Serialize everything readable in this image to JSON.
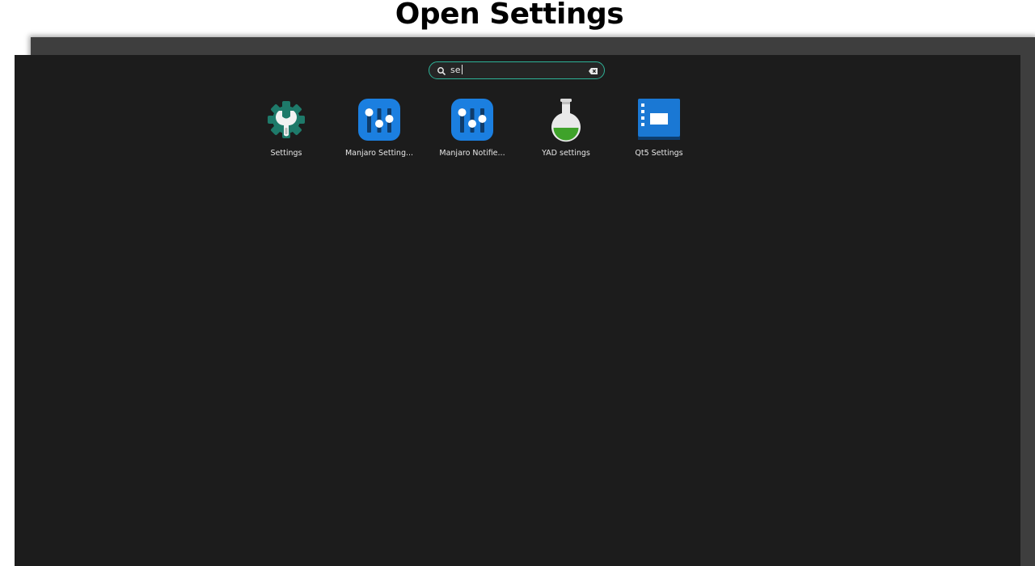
{
  "caption": "Open Settings",
  "search": {
    "value": "se",
    "icons": {
      "search": "search-icon",
      "clear": "backspace-clear-icon"
    }
  },
  "apps": [
    {
      "label": "Settings",
      "icon": "wrench-gear-icon"
    },
    {
      "label": "Manjaro Setting...",
      "icon": "sliders-icon"
    },
    {
      "label": "Manjaro Notifie...",
      "icon": "sliders-icon"
    },
    {
      "label": "YAD settings",
      "icon": "flask-icon"
    },
    {
      "label": "Qt5 Settings",
      "icon": "window-panel-icon"
    }
  ],
  "colors": {
    "overlay_bg": "#1c1c1c",
    "search_border": "#2eb398",
    "settings_icon": "#1e7a6a",
    "manjaro_icon": "#1b7fe0",
    "flask_liquid": "#3fa22a",
    "qt_icon": "#1a78d4"
  }
}
